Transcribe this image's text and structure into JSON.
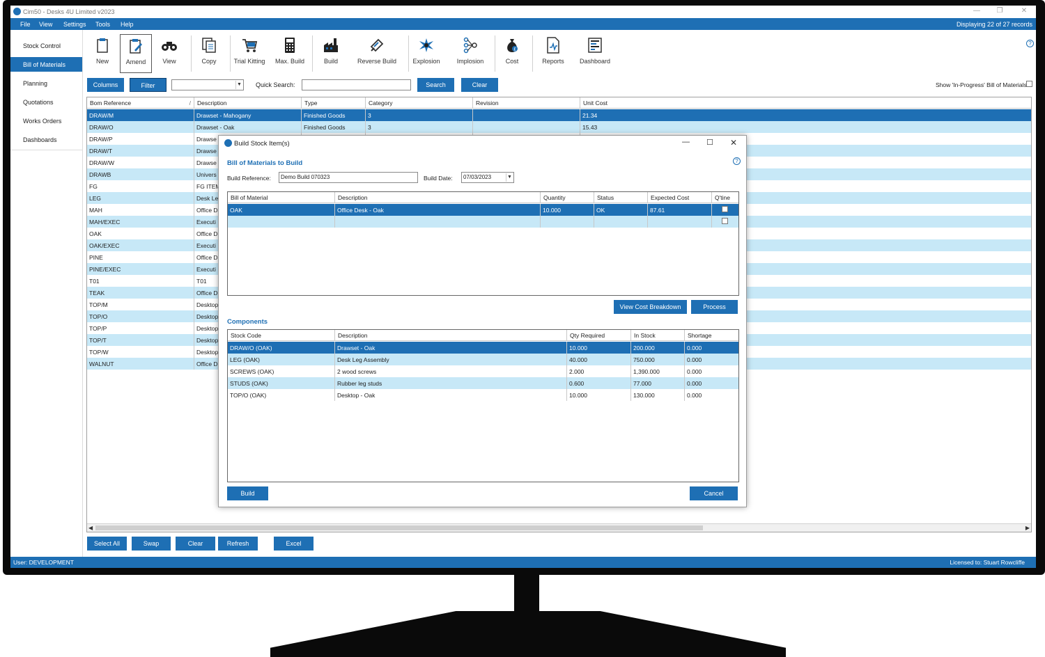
{
  "window": {
    "title": "Cim50 - Desks 4U Limited v2023",
    "menu": [
      "File",
      "View",
      "Settings",
      "Tools",
      "Help"
    ],
    "records_text": "Displaying 22 of 27 records"
  },
  "sidebar": {
    "items": [
      "Stock Control",
      "Bill of Materials",
      "Planning",
      "Quotations",
      "Works Orders",
      "Dashboards"
    ]
  },
  "toolbar": {
    "items": [
      {
        "label": "New",
        "icon": "clipboard-icon"
      },
      {
        "label": "Amend",
        "icon": "edit-clipboard-icon"
      },
      {
        "label": "View",
        "icon": "binoculars-icon"
      },
      {
        "label": "Copy",
        "icon": "copy-icon"
      },
      {
        "label": "Trial Kitting",
        "icon": "cart-icon"
      },
      {
        "label": "Max. Build",
        "icon": "calculator-icon"
      },
      {
        "label": "Build",
        "icon": "factory-icon"
      },
      {
        "label": "Reverse Build",
        "icon": "reverse-build-icon"
      },
      {
        "label": "Explosion",
        "icon": "explosion-icon"
      },
      {
        "label": "Implosion",
        "icon": "implosion-icon"
      },
      {
        "label": "Cost",
        "icon": "money-bag-icon"
      },
      {
        "label": "Reports",
        "icon": "report-icon"
      },
      {
        "label": "Dashboard",
        "icon": "dashboard-icon"
      }
    ]
  },
  "filterbar": {
    "columns_label": "Columns",
    "filter_label": "Filter",
    "quick_search_label": "Quick Search:",
    "search_label": "Search",
    "clear_label": "Clear",
    "show_in_progress_label": "Show 'In-Progress' Bill of Materials"
  },
  "grid": {
    "headers": [
      "Bom Reference",
      "Description",
      "Type",
      "Category",
      "Revision",
      "Unit Cost"
    ],
    "rows": [
      [
        "DRAW/M",
        "Drawset - Mahogany",
        "Finished Goods",
        "3",
        "",
        "21.34"
      ],
      [
        "DRAW/O",
        "Drawset - Oak",
        "Finished Goods",
        "3",
        "",
        "15.43"
      ],
      [
        "DRAW/P",
        "Drawse",
        "",
        "",
        "",
        ""
      ],
      [
        "DRAW/T",
        "Drawse",
        "",
        "",
        "",
        ""
      ],
      [
        "DRAW/W",
        "Drawse",
        "",
        "",
        "",
        ""
      ],
      [
        "DRAWB",
        "Univers",
        "",
        "",
        "",
        ""
      ],
      [
        "FG",
        "FG ITEM",
        "",
        "",
        "",
        ""
      ],
      [
        "LEG",
        "Desk Le",
        "",
        "",
        "",
        ""
      ],
      [
        "MAH",
        "Office D",
        "",
        "",
        "",
        ""
      ],
      [
        "MAH/EXEC",
        "Executi",
        "",
        "",
        "",
        ""
      ],
      [
        "OAK",
        "Office D",
        "",
        "",
        "",
        ""
      ],
      [
        "OAK/EXEC",
        "Executi",
        "",
        "",
        "",
        ""
      ],
      [
        "PINE",
        "Office D",
        "",
        "",
        "",
        ""
      ],
      [
        "PINE/EXEC",
        "Executi",
        "",
        "",
        "",
        ""
      ],
      [
        "T01",
        "T01",
        "",
        "",
        "",
        ""
      ],
      [
        "TEAK",
        "Office D",
        "",
        "",
        "",
        ""
      ],
      [
        "TOP/M",
        "Desktop",
        "",
        "",
        "",
        ""
      ],
      [
        "TOP/O",
        "Desktop",
        "",
        "",
        "",
        ""
      ],
      [
        "TOP/P",
        "Desktop",
        "",
        "",
        "",
        ""
      ],
      [
        "TOP/T",
        "Desktop",
        "",
        "",
        "",
        ""
      ],
      [
        "TOP/W",
        "Desktop",
        "",
        "",
        "",
        ""
      ],
      [
        "WALNUT",
        "Office D",
        "",
        "",
        "",
        ""
      ]
    ]
  },
  "bottombar": {
    "select_all": "Select All",
    "swap": "Swap",
    "clear": "Clear",
    "refresh": "Refresh",
    "excel": "Excel"
  },
  "status": {
    "user": "User:  DEVELOPMENT",
    "licensed": "Licensed to: Stuart Rowcliffe"
  },
  "dialog": {
    "title": "Build Stock Item(s)",
    "bom_section": "Bill of Materials to Build",
    "build_ref_label": "Build Reference:",
    "build_ref_value": "Demo Build 070323",
    "build_date_label": "Build Date:",
    "build_date_value": "07/03/2023",
    "bom_headers": [
      "Bill of Material",
      "Description",
      "Quantity",
      "Status",
      "Expected Cost",
      "Q'tine"
    ],
    "bom_rows": [
      [
        "OAK",
        "Office Desk - Oak",
        "10.000",
        "OK",
        "87.61",
        ""
      ],
      [
        "",
        "",
        "",
        "",
        "",
        ""
      ]
    ],
    "view_cost_label": "View Cost Breakdown",
    "process_label": "Process",
    "components_section": "Components",
    "comp_headers": [
      "Stock Code",
      "Description",
      "Qty Required",
      "In Stock",
      "Shortage"
    ],
    "comp_rows": [
      [
        "DRAW/O (OAK)",
        "Drawset - Oak",
        "10.000",
        "200.000",
        "0.000"
      ],
      [
        "LEG (OAK)",
        "Desk Leg Assembly",
        "40.000",
        "750.000",
        "0.000"
      ],
      [
        "SCREWS (OAK)",
        "2 wood screws",
        "2.000",
        "1,390.000",
        "0.000"
      ],
      [
        "STUDS (OAK)",
        "Rubber leg studs",
        "0.600",
        "77.000",
        "0.000"
      ],
      [
        "TOP/O (OAK)",
        "Desktop - Oak",
        "10.000",
        "130.000",
        "0.000"
      ]
    ],
    "build_label": "Build",
    "cancel_label": "Cancel"
  },
  "colors": {
    "accent": "#1e6fb4",
    "row_alt": "#c7e8f7"
  }
}
